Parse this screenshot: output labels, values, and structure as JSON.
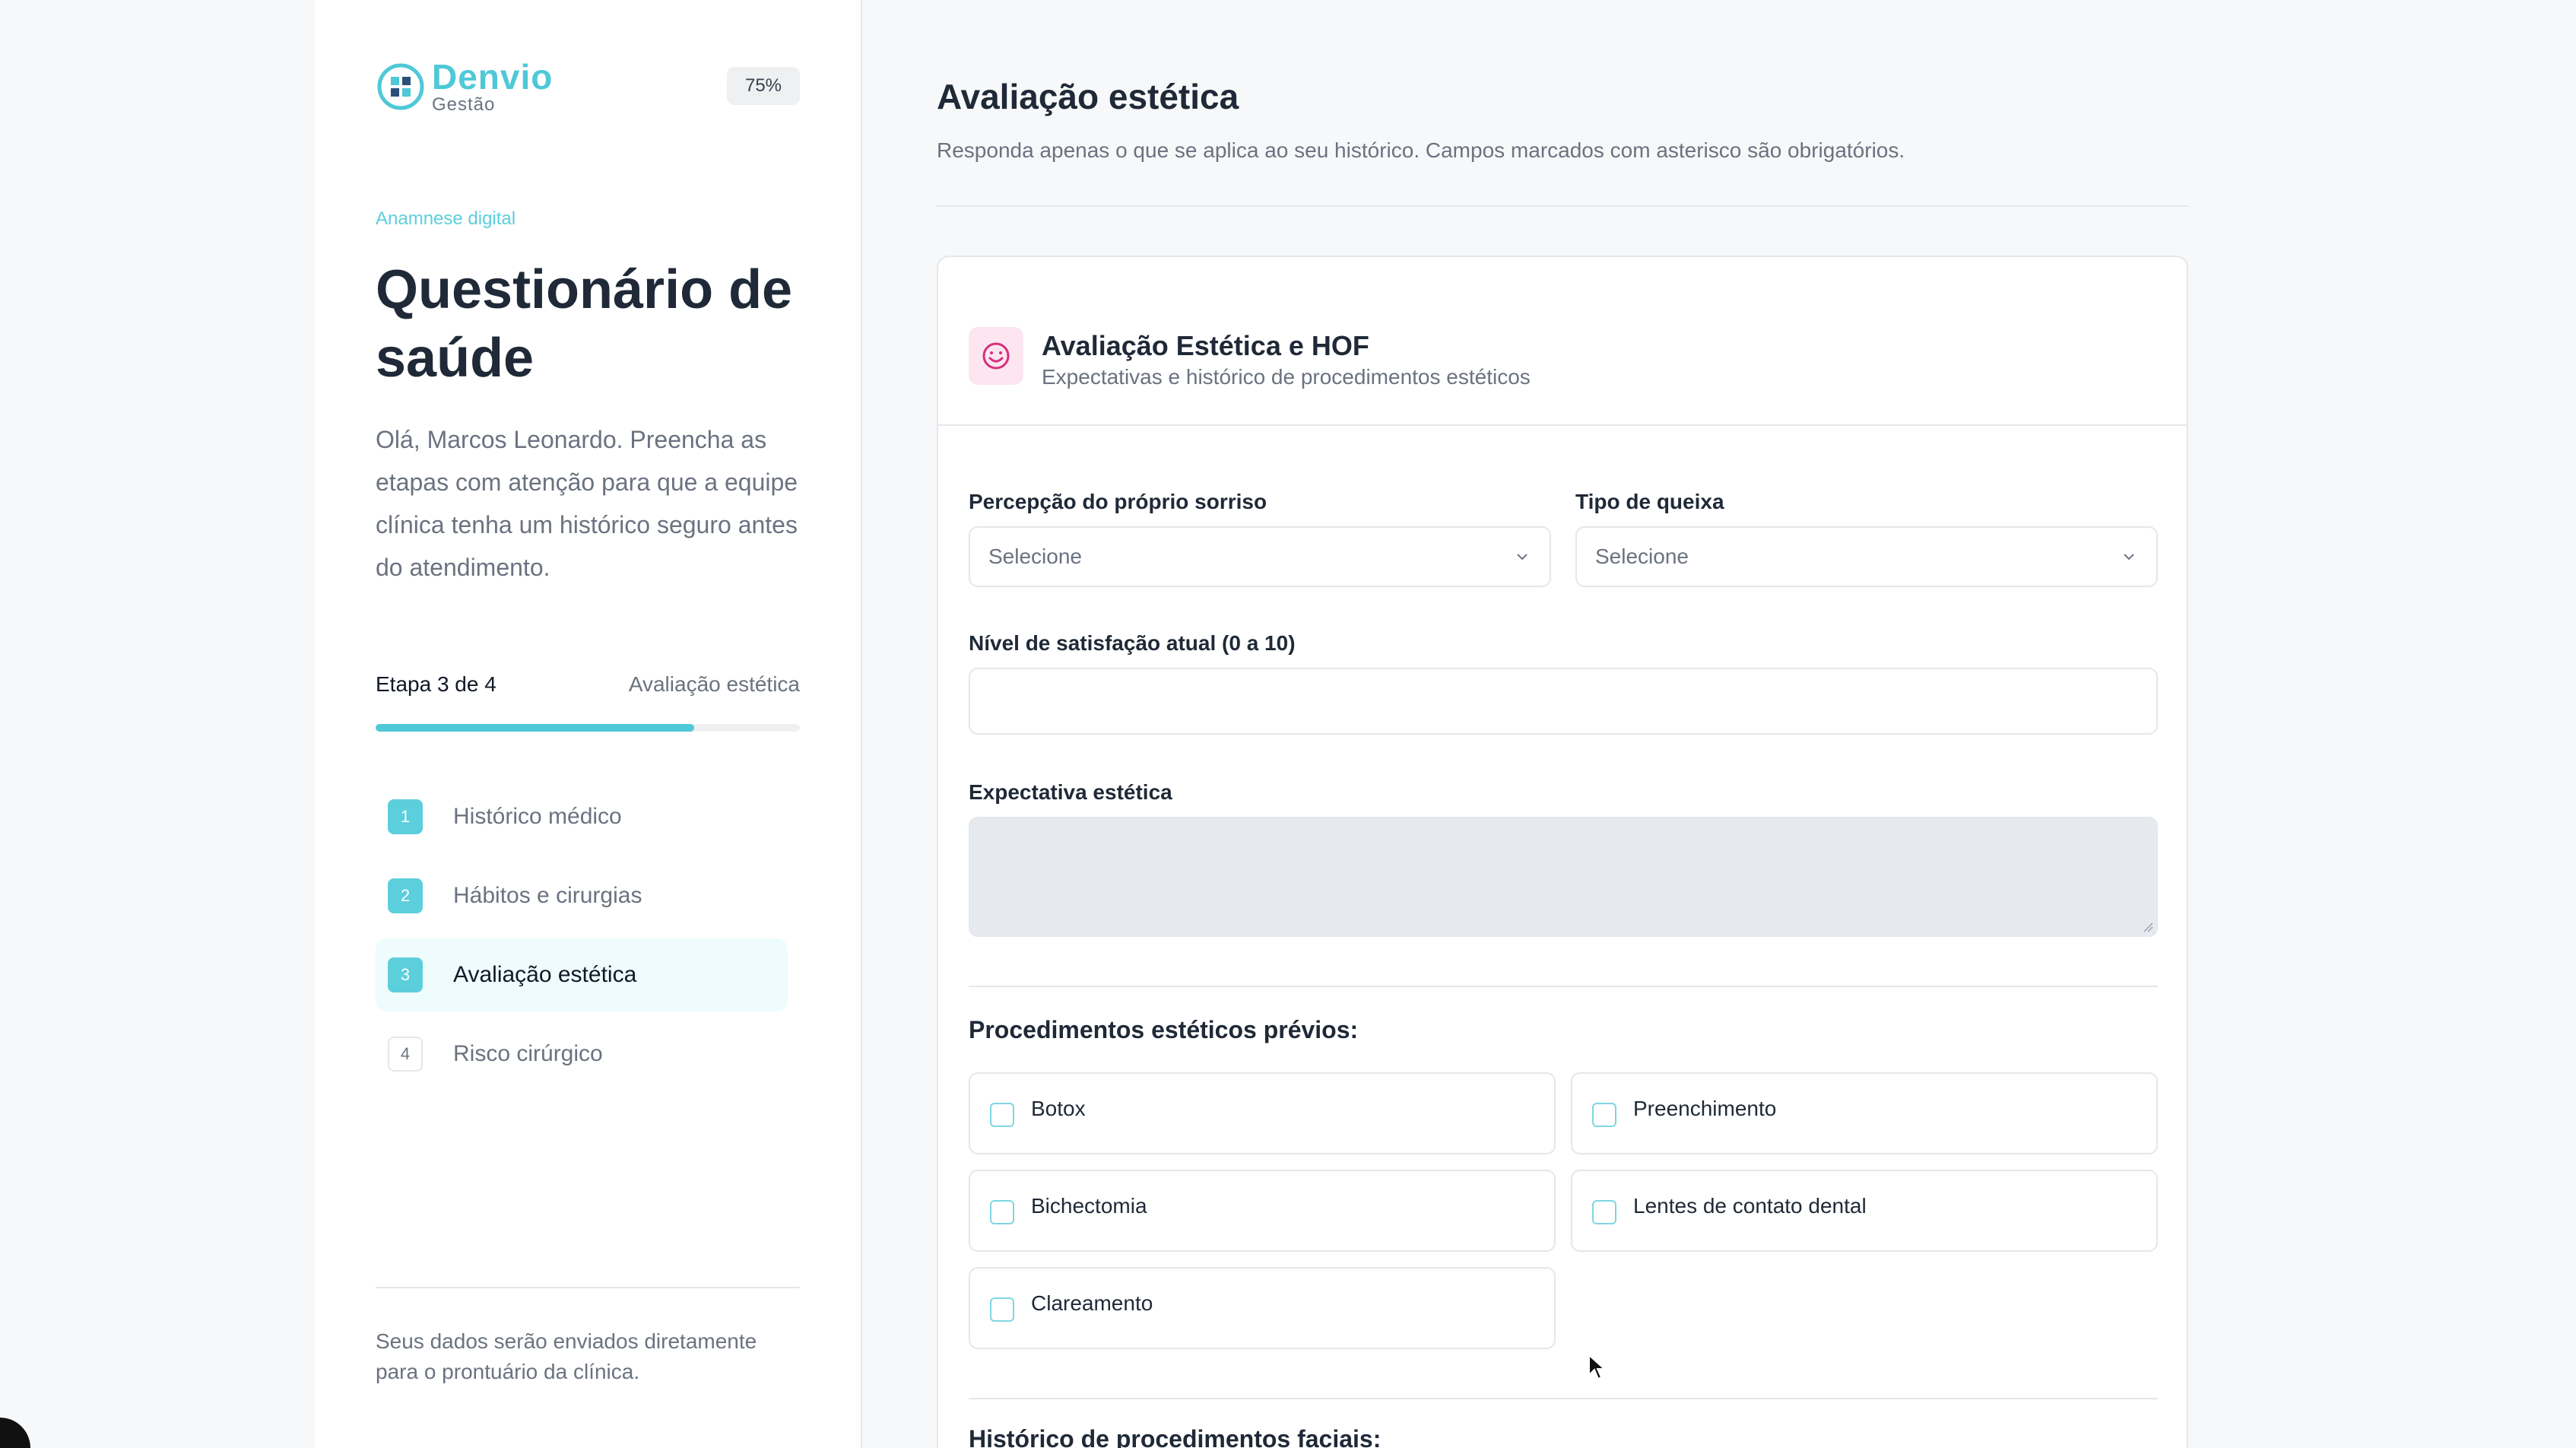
{
  "sidebar": {
    "brand_name": "Denvio",
    "brand_sub": "Gestão",
    "progress_badge": "75%",
    "progress_fraction": 0.75,
    "eyebrow": "Anamnese digital",
    "title": "Questionário de saúde",
    "intro": "Olá, Marcos Leonardo. Preencha as etapas com atenção para que a equipe clínica tenha um histórico seguro antes do atendimento.",
    "step_label": "Etapa 3 de 4",
    "step_current": "Avaliação estética",
    "steps": [
      {
        "num": "1",
        "label": "Histórico médico"
      },
      {
        "num": "2",
        "label": "Hábitos e cirurgias"
      },
      {
        "num": "3",
        "label": "Avaliação estética"
      },
      {
        "num": "4",
        "label": "Risco cirúrgico"
      }
    ],
    "footer": "Seus dados serão enviados diretamente para o prontuário da clínica."
  },
  "main": {
    "title": "Avaliação estética",
    "subtitle": "Responda apenas o que se aplica ao seu histórico. Campos marcados com asterisco são obrigatórios.",
    "card": {
      "title": "Avaliação Estética e HOF",
      "subtitle": "Expectativas e histórico de procedimentos estéticos",
      "icon": "smile-icon",
      "fields": {
        "smile_label": "Percepção do próprio sorriso",
        "smile_value": "Selecione",
        "complaint_label": "Tipo de queixa",
        "complaint_value": "Selecione",
        "satisfaction_label": "Nível de satisfação atual (0 a 10)",
        "satisfaction_value": "",
        "expectation_label": "Expectativa estética",
        "expectation_value": ""
      },
      "procedures_title": "Procedimentos estéticos prévios:",
      "procedures": [
        "Botox",
        "Preenchimento",
        "Bichectomia",
        "Lentes de contato dental",
        "Clareamento"
      ],
      "facial_title": "Histórico de procedimentos faciais:"
    }
  },
  "colors": {
    "accent": "#4fc8d8",
    "accent_light": "#eefcfd",
    "icon_bg": "#fde6f0",
    "icon_fg": "#d6307a"
  }
}
